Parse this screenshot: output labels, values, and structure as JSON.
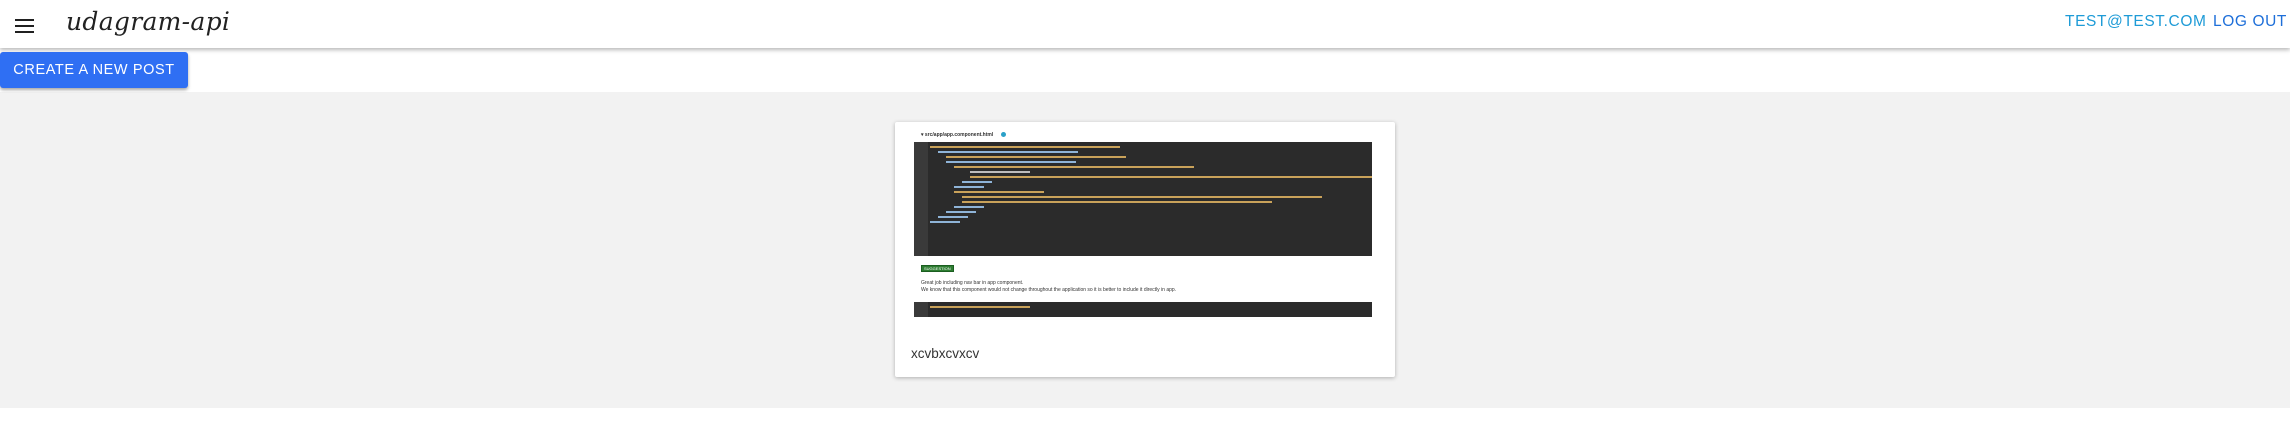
{
  "header": {
    "brand": "udagram-api",
    "user_email": "TEST@TEST.COM",
    "logout_label": "LOG OUT"
  },
  "actions": {
    "create_post_label": "CREATE A NEW POST"
  },
  "posts": [
    {
      "caption": "xcvbxcvxcv",
      "image": {
        "file_path": "▾ src/app/app.component.html",
        "review_tag": "SUGGESTION",
        "review_line_1": "Great job including nav bar in app component.",
        "review_line_2": "We know that this component would not change throughout the application so it is better to include it directly in app."
      }
    }
  ],
  "colors": {
    "accent": "#2f6ff3",
    "link": "#1e9bd7",
    "background": "#f2f2f2"
  }
}
